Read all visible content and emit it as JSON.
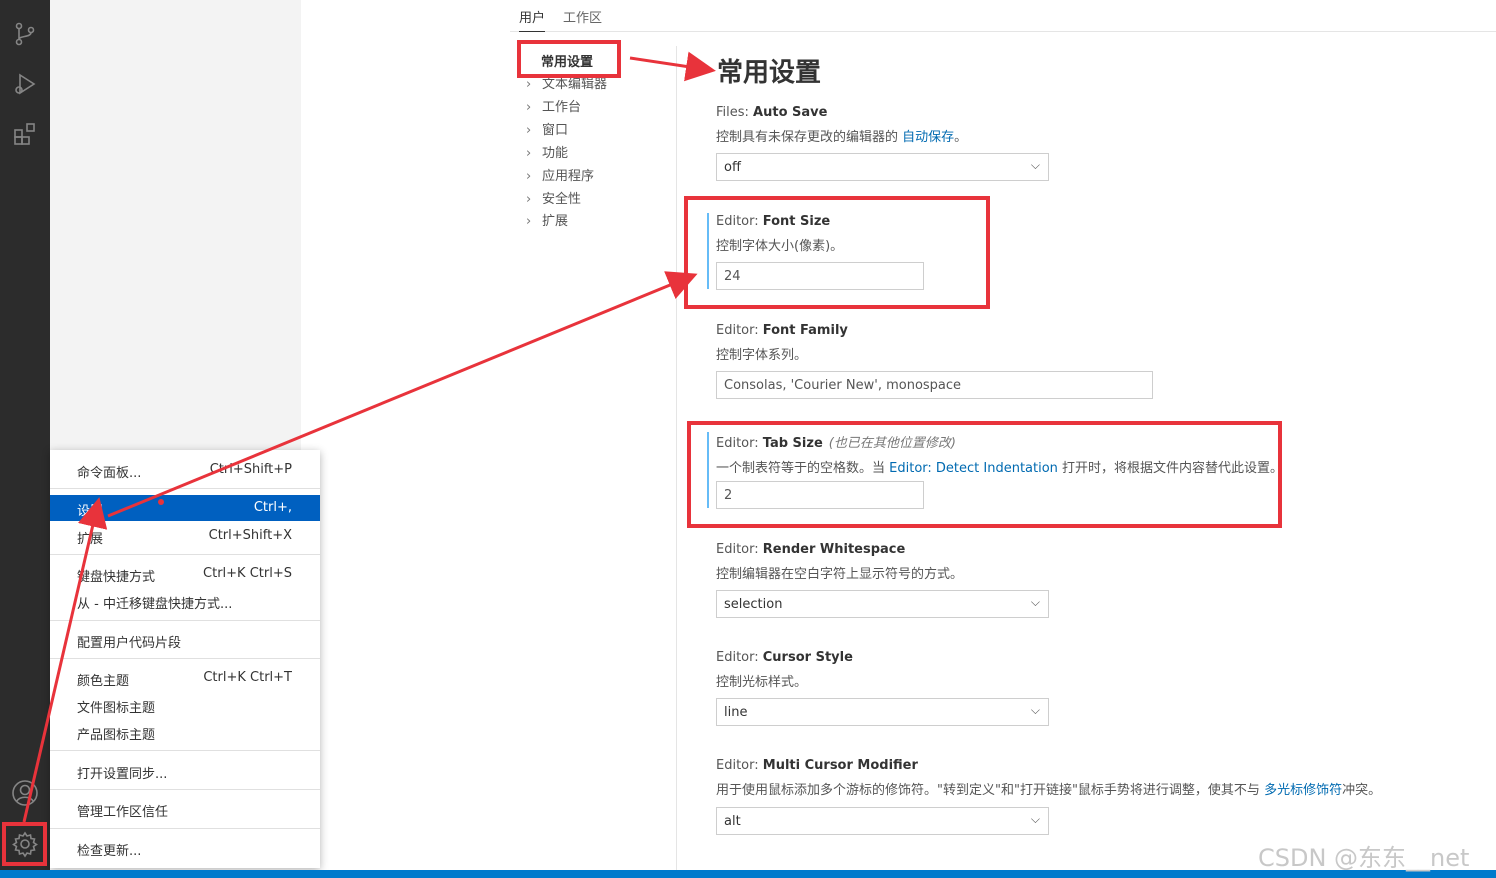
{
  "tabs": {
    "user": "用户",
    "workspace": "工作区"
  },
  "toc": {
    "first": "常用设置",
    "items": [
      "文本编辑器",
      "工作台",
      "窗口",
      "功能",
      "应用程序",
      "安全性",
      "扩展"
    ]
  },
  "page_title": "常用设置",
  "settings": {
    "auto_save": {
      "category": "Files: ",
      "name": "Auto Save",
      "desc_pre": "控制具有未保存更改的编辑器的 ",
      "desc_link": "自动保存",
      "desc_post": "。",
      "value": "off"
    },
    "font_size": {
      "category": "Editor: ",
      "name": "Font Size",
      "desc": "控制字体大小(像素)。",
      "value": "24"
    },
    "font_family": {
      "category": "Editor: ",
      "name": "Font Family",
      "desc": "控制字体系列。",
      "value": "Consolas, 'Courier New', monospace"
    },
    "tab_size": {
      "category": "Editor: ",
      "name": "Tab Size",
      "modified": "(也已在其他位置修改)",
      "desc_pre": "一个制表符等于的空格数。当 ",
      "desc_link": "Editor: Detect Indentation",
      "desc_post": " 打开时，将根据文件内容替代此设置。",
      "value": "2"
    },
    "render_whitespace": {
      "category": "Editor: ",
      "name": "Render Whitespace",
      "desc": "控制编辑器在空白字符上显示符号的方式。",
      "value": "selection"
    },
    "cursor_style": {
      "category": "Editor: ",
      "name": "Cursor Style",
      "desc": "控制光标样式。",
      "value": "line"
    },
    "multi_cursor": {
      "category": "Editor: ",
      "name": "Multi Cursor Modifier",
      "desc_pre": "用于使用鼠标添加多个游标的修饰符。\"转到定义\"和\"打开链接\"鼠标手势将进行调整，使其不与 ",
      "desc_link": "多光标修饰符",
      "desc_post": "冲突。",
      "value": "alt"
    }
  },
  "menu": {
    "command_palette": {
      "label": "命令面板...",
      "key": "Ctrl+Shift+P"
    },
    "settings": {
      "label": "设置",
      "key": "Ctrl+,"
    },
    "extensions": {
      "label": "扩展",
      "key": "Ctrl+Shift+X"
    },
    "keyboard_shortcuts": {
      "label": "键盘快捷方式",
      "key": "Ctrl+K Ctrl+S"
    },
    "migrate_keymaps": {
      "label": "从 - 中迁移键盘快捷方式..."
    },
    "user_snippets": {
      "label": "配置用户代码片段"
    },
    "color_theme": {
      "label": "颜色主题",
      "key": "Ctrl+K Ctrl+T"
    },
    "file_icon_theme": {
      "label": "文件图标主题"
    },
    "product_icon_theme": {
      "label": "产品图标主题"
    },
    "settings_sync": {
      "label": "打开设置同步..."
    },
    "workspace_trust": {
      "label": "管理工作区信任"
    },
    "check_updates": {
      "label": "检查更新..."
    }
  },
  "activity_icons": [
    "source-control-icon",
    "run-debug-icon",
    "extensions-icon",
    "account-icon",
    "gear-icon"
  ],
  "annotation_color": "#e8333b",
  "watermark": "CSDN @东东__net"
}
